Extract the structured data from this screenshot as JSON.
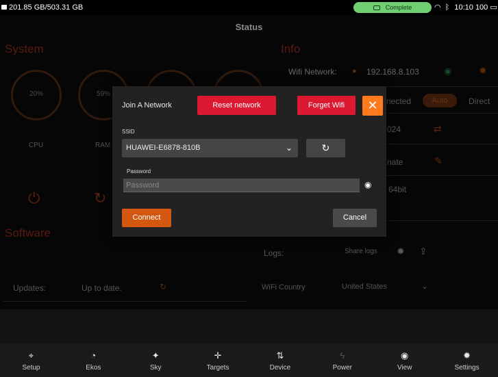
{
  "status_bar": {
    "storage": "201.85 GB/503.31 GB",
    "status_pill": "Complete",
    "time": "10:10",
    "battery": "100"
  },
  "app": {
    "title": "Status",
    "system": {
      "title": "System",
      "gauges": [
        {
          "value": "20%",
          "label": "CPU"
        },
        {
          "value": "59%",
          "label": "RAM"
        }
      ]
    },
    "info": {
      "title": "Info",
      "wifi_label": "Wifi Network:",
      "ip": "192.168.8.103",
      "connected_text": "nected",
      "auto": "Auto",
      "direct": "Direct",
      "partial_1": "024",
      "partial_2": "nate",
      "partial_3": "64bit"
    },
    "software": {
      "title": "Software",
      "updates_label": "Updates:",
      "updates_value": "Up to date."
    },
    "logs": {
      "label": "Logs:",
      "share": "Share logs"
    },
    "wifi_country": {
      "label": "WiFi Country",
      "value": "United States"
    }
  },
  "modal": {
    "title": "Join A Network",
    "reset_label": "Reset network",
    "forget_label": "Forget Wifi",
    "ssid_label": "SSID",
    "ssid_value": "HUAWEI-E6878-810B",
    "password_label": "Password",
    "password_placeholder": "Password",
    "connect_label": "Connect",
    "cancel_label": "Cancel"
  },
  "nav": [
    {
      "label": "Setup",
      "icon": "setup-icon"
    },
    {
      "label": "Ekos",
      "icon": "ekos-icon"
    },
    {
      "label": "Sky",
      "icon": "sky-icon"
    },
    {
      "label": "Targets",
      "icon": "targets-icon"
    },
    {
      "label": "Device",
      "icon": "device-icon"
    },
    {
      "label": "Power",
      "icon": "power-icon"
    },
    {
      "label": "View",
      "icon": "view-icon"
    },
    {
      "label": "Settings",
      "icon": "settings-icon"
    }
  ],
  "colors": {
    "accent_orange": "#d4570f",
    "danger_red": "#dc1930",
    "close_orange": "#ff7a1a",
    "pill_green": "#6fcf72"
  }
}
